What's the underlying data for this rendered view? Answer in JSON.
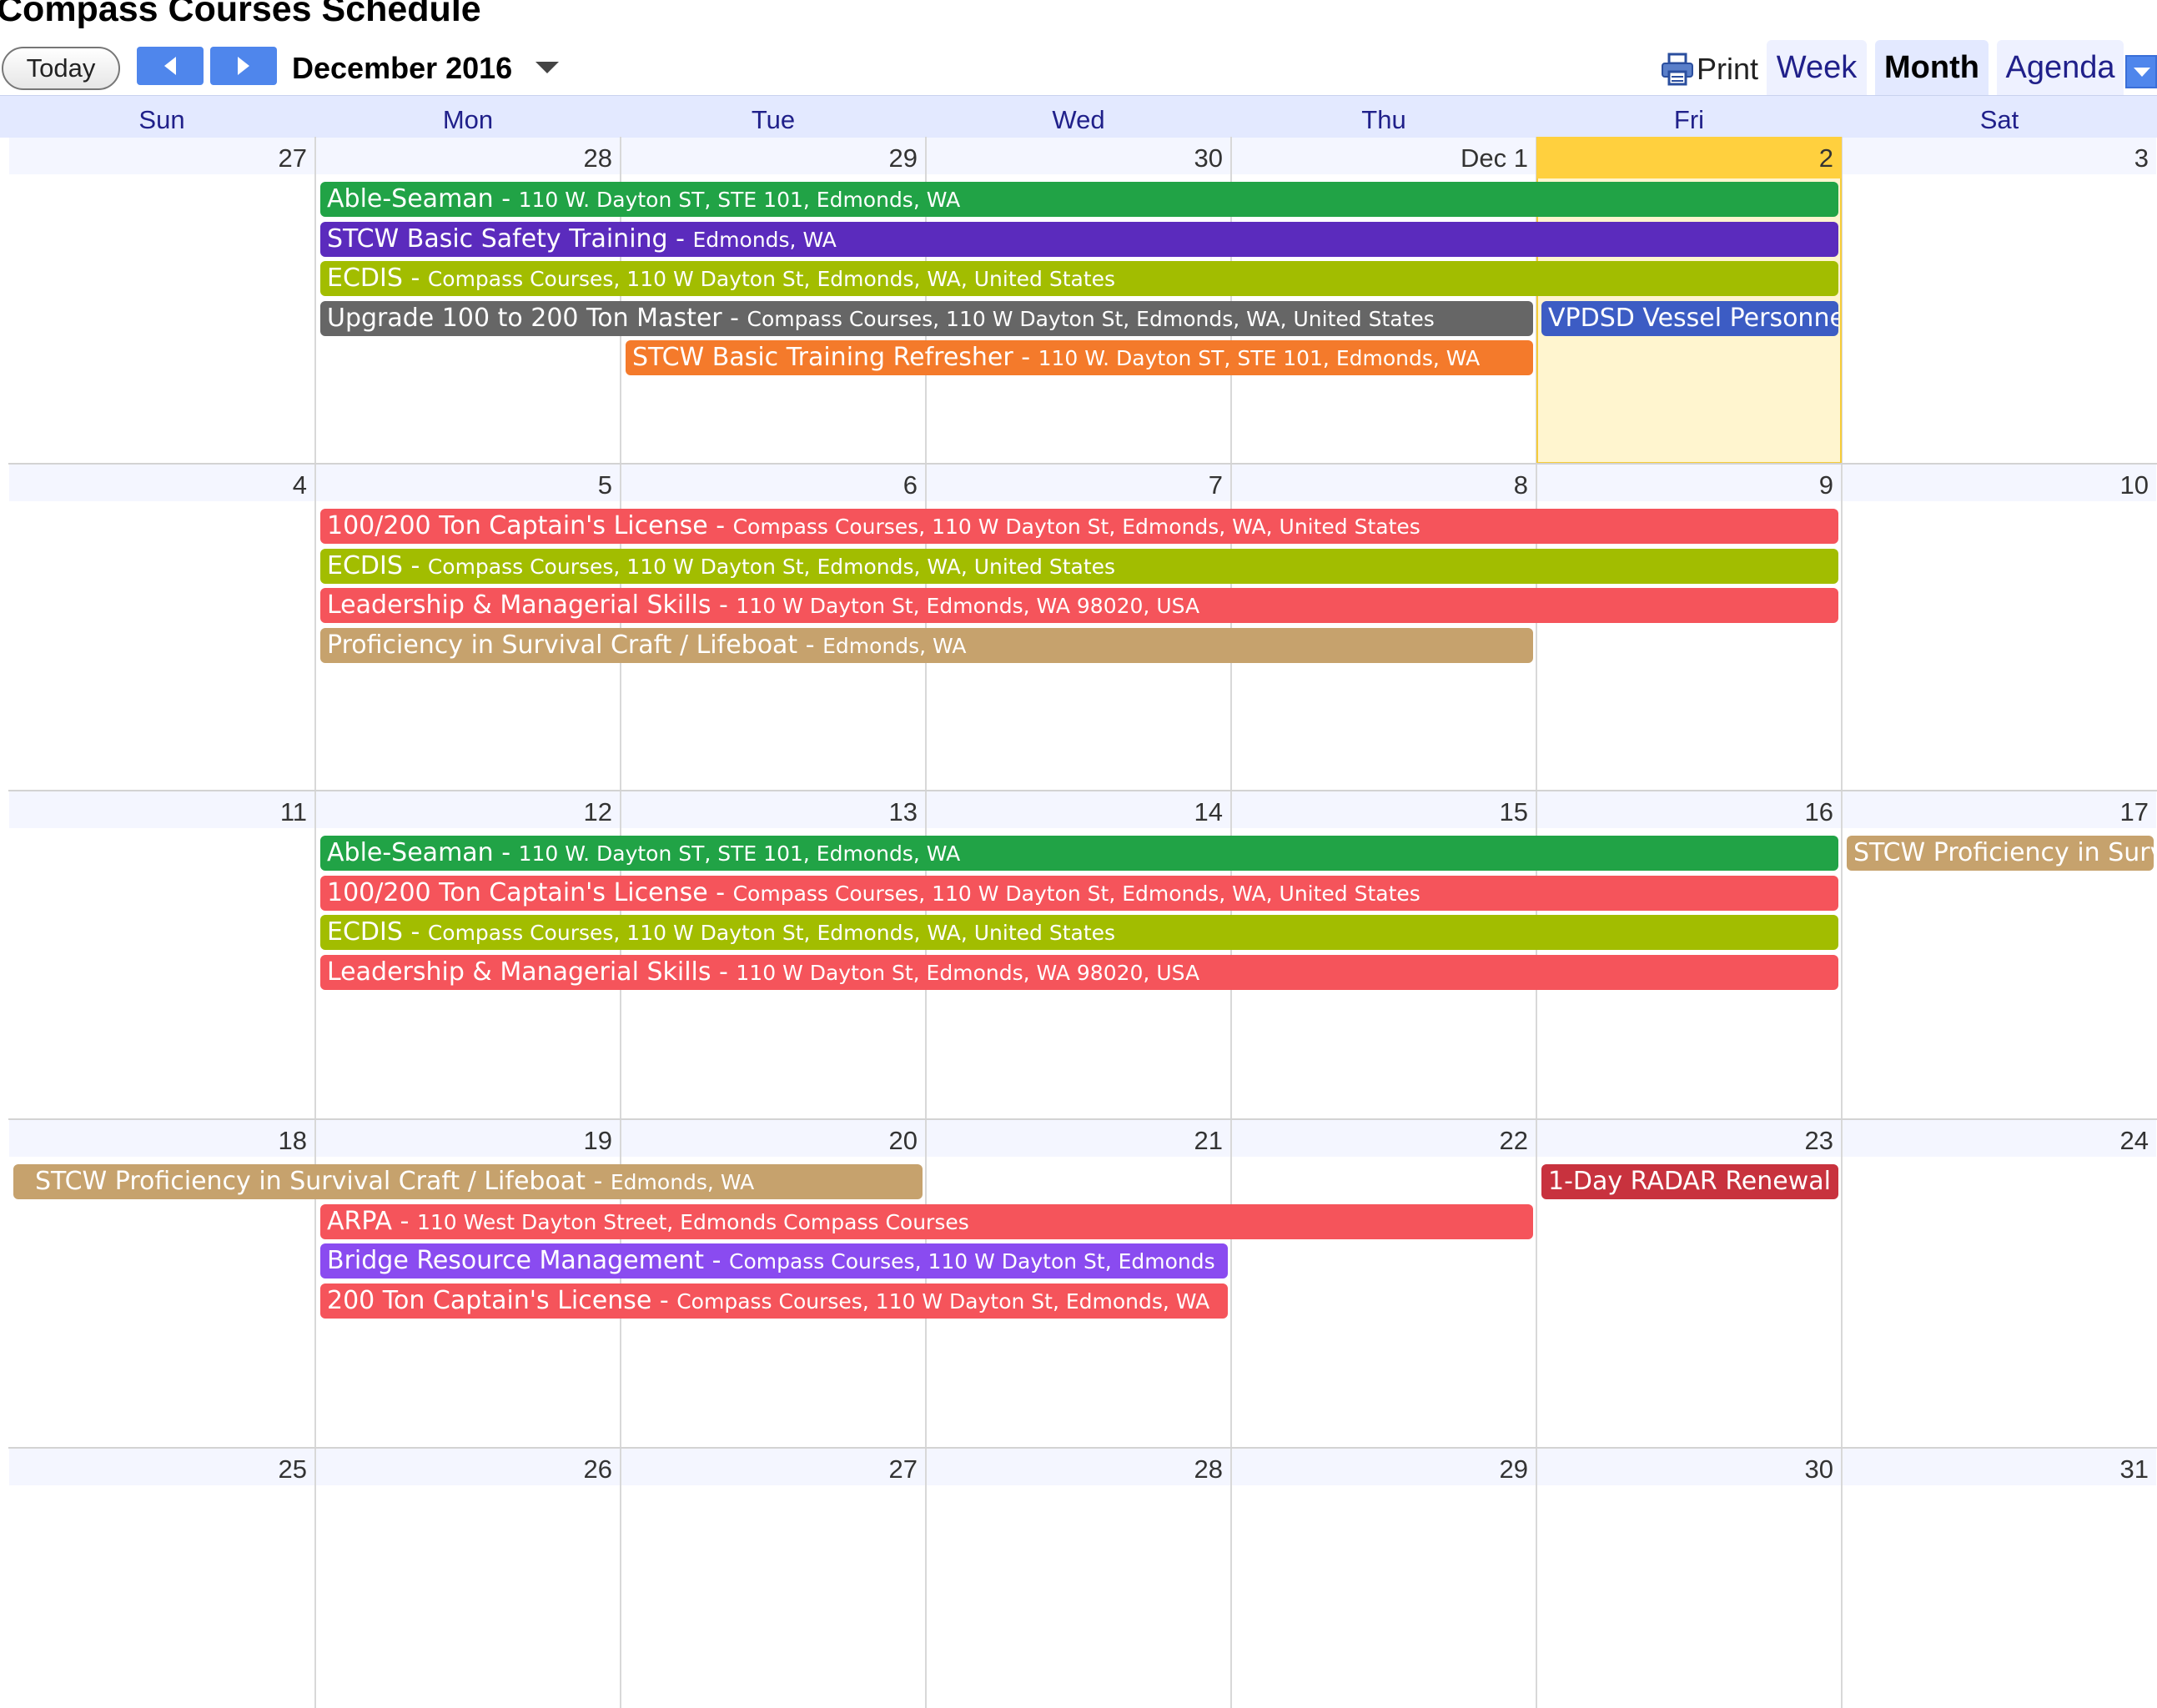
{
  "header": {
    "title": "Compass Courses Schedule",
    "today_label": "Today",
    "month_label": "December 2016",
    "print_label": "Print",
    "views": [
      "Week",
      "Month",
      "Agenda"
    ],
    "active_view": "Month"
  },
  "weekdays": [
    "Sun",
    "Mon",
    "Tue",
    "Wed",
    "Thu",
    "Fri",
    "Sat"
  ],
  "weeks": [
    {
      "dates": [
        "27",
        "28",
        "29",
        "30",
        "Dec 1",
        "2",
        "3"
      ],
      "today_index": 5,
      "events": [
        {
          "title": "Able-Seaman",
          "location": "110 W. Dayton ST, STE 101, Edmonds, WA",
          "color": "#21a346",
          "start": 1,
          "span": 5,
          "lane": 0
        },
        {
          "title": "STCW Basic Safety Training",
          "location": "Edmonds, WA",
          "color": "#5b2bbd",
          "start": 1,
          "span": 5,
          "lane": 1
        },
        {
          "title": "ECDIS",
          "location": "Compass Courses, 110 W Dayton St, Edmonds, WA, United States",
          "color": "#a2bd00",
          "start": 1,
          "span": 5,
          "lane": 2
        },
        {
          "title": "Upgrade 100 to 200 Ton Master",
          "location": "Compass Courses, 110 W Dayton St, Edmonds, WA, United States",
          "color": "#666666",
          "start": 1,
          "span": 4,
          "lane": 3
        },
        {
          "title": "VPDSD Vessel Personnel with Designated Security Duties",
          "location": "",
          "color": "#3c5cc4",
          "start": 5,
          "span": 1,
          "lane": 3
        },
        {
          "title": "STCW Basic Training Refresher",
          "location": "110 W. Dayton ST, STE 101, Edmonds, WA",
          "color": "#f47a2b",
          "start": 2,
          "span": 3,
          "lane": 4
        }
      ]
    },
    {
      "dates": [
        "4",
        "5",
        "6",
        "7",
        "8",
        "9",
        "10"
      ],
      "today_index": -1,
      "events": [
        {
          "title": "100/200 Ton Captain's License",
          "location": "Compass Courses, 110 W Dayton St, Edmonds, WA, United States",
          "color": "#f5545b",
          "start": 1,
          "span": 5,
          "lane": 0
        },
        {
          "title": "ECDIS",
          "location": "Compass Courses, 110 W Dayton St, Edmonds, WA, United States",
          "color": "#a2bd00",
          "start": 1,
          "span": 5,
          "lane": 1
        },
        {
          "title": "Leadership & Managerial Skills",
          "location": "110 W Dayton St, Edmonds, WA 98020, USA",
          "color": "#f5545b",
          "start": 1,
          "span": 5,
          "lane": 2
        },
        {
          "title": "Proficiency in Survival Craft / Lifeboat",
          "location": "Edmonds, WA",
          "color": "#c6a26d",
          "start": 1,
          "span": 4,
          "lane": 3
        }
      ]
    },
    {
      "dates": [
        "11",
        "12",
        "13",
        "14",
        "15",
        "16",
        "17"
      ],
      "today_index": -1,
      "events": [
        {
          "title": "Able-Seaman",
          "location": "110 W. Dayton ST, STE 101, Edmonds, WA",
          "color": "#21a346",
          "start": 1,
          "span": 5,
          "lane": 0
        },
        {
          "title": "STCW Proficiency in Survival Craft / Lifeboat",
          "location": "",
          "color": "#c6a26d",
          "start": 6,
          "span": 1,
          "lane": 0
        },
        {
          "title": "100/200 Ton Captain's License",
          "location": "Compass Courses, 110 W Dayton St, Edmonds, WA, United States",
          "color": "#f5545b",
          "start": 1,
          "span": 5,
          "lane": 1
        },
        {
          "title": "ECDIS",
          "location": "Compass Courses, 110 W Dayton St, Edmonds, WA, United States",
          "color": "#a2bd00",
          "start": 1,
          "span": 5,
          "lane": 2
        },
        {
          "title": "Leadership & Managerial Skills",
          "location": "110 W Dayton St, Edmonds, WA 98020, USA",
          "color": "#f5545b",
          "start": 1,
          "span": 5,
          "lane": 3
        }
      ]
    },
    {
      "dates": [
        "18",
        "19",
        "20",
        "21",
        "22",
        "23",
        "24"
      ],
      "today_index": -1,
      "events": [
        {
          "title": "STCW Proficiency in Survival Craft / Lifeboat",
          "location": "Edmonds, WA",
          "color": "#c6a26d",
          "start": 0,
          "span": 3,
          "lane": 0,
          "indent": true
        },
        {
          "title": "1-Day RADAR Renewal",
          "location": "",
          "color": "#c8323e",
          "start": 5,
          "span": 1,
          "lane": 0
        },
        {
          "title": "ARPA",
          "location": "110 West Dayton Street, Edmonds Compass Courses",
          "color": "#f5545b",
          "start": 1,
          "span": 4,
          "lane": 1
        },
        {
          "title": "Bridge Resource Management",
          "location": "Compass Courses, 110 W Dayton St, Edmonds",
          "color": "#8a4bf0",
          "start": 1,
          "span": 3,
          "lane": 2
        },
        {
          "title": "200 Ton Captain's License",
          "location": "Compass Courses, 110 W Dayton St, Edmonds, WA",
          "color": "#f5545b",
          "start": 1,
          "span": 3,
          "lane": 3
        }
      ]
    },
    {
      "dates": [
        "25",
        "26",
        "27",
        "28",
        "29",
        "30",
        "31"
      ],
      "today_index": -1,
      "events": []
    }
  ],
  "icons": {
    "prev": "chevron-left-icon",
    "next": "chevron-right-icon",
    "month_dropdown": "caret-down-icon",
    "print": "printer-icon",
    "agenda_dropdown": "caret-down-icon"
  },
  "colors": {
    "header_band": "#e3e9ff",
    "today_highlight": "#fff5cf",
    "today_header": "#ffd03e",
    "nav_button": "#4f86ec"
  }
}
